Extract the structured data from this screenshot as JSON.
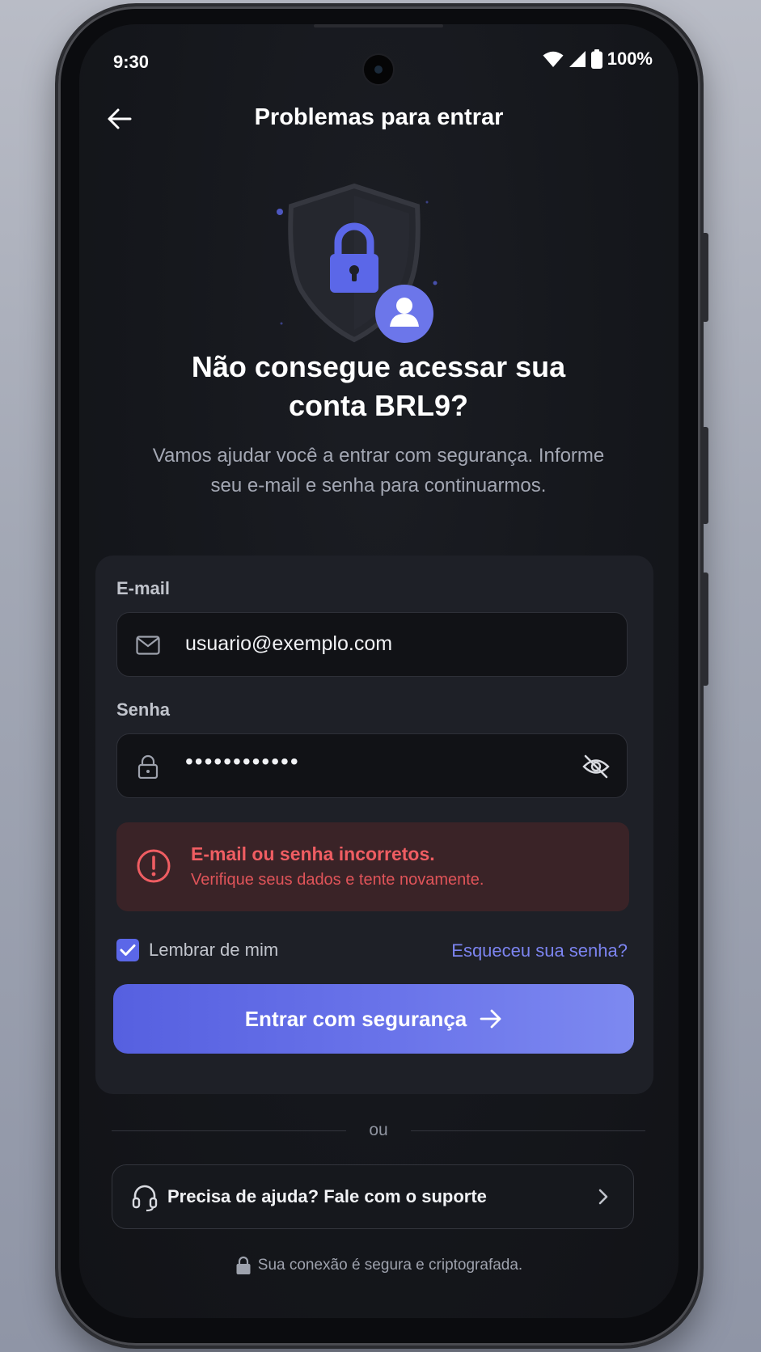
{
  "status_bar": {
    "time": "9:30",
    "battery": "100%"
  },
  "header": {
    "title": "Problemas para entrar"
  },
  "hero": {
    "icon": "shield-lock-user"
  },
  "headline": {
    "line1": "Não consegue acessar sua",
    "line2": "conta BRL9?"
  },
  "subtext": {
    "line1": "Vamos ajudar você a entrar com segurança. Informe",
    "line2": "seu e-mail e senha para continuarmos."
  },
  "form": {
    "email_label": "E-mail",
    "email_value": "usuario@exemplo.com",
    "password_label": "Senha",
    "password_value": "••••••••••••",
    "error_title": "E-mail ou senha incorretos.",
    "error_detail": "Verifique seus dados e tente novamente.",
    "remember_label": "Lembrar de mim",
    "remember_checked": true,
    "forgot_link": "Esqueceu sua senha?",
    "submit_label": "Entrar com segurança"
  },
  "divider": {
    "text": "ou"
  },
  "support": {
    "label": "Precisa de ajuda? Fale com o suporte"
  },
  "footer": {
    "secure_text": "Sua conexão é segura e criptografada."
  },
  "colors": {
    "accent": "#5b67e8",
    "error": "#ef5d62",
    "background": "#15171c",
    "card": "#1e2027",
    "link": "#7c84f0"
  }
}
